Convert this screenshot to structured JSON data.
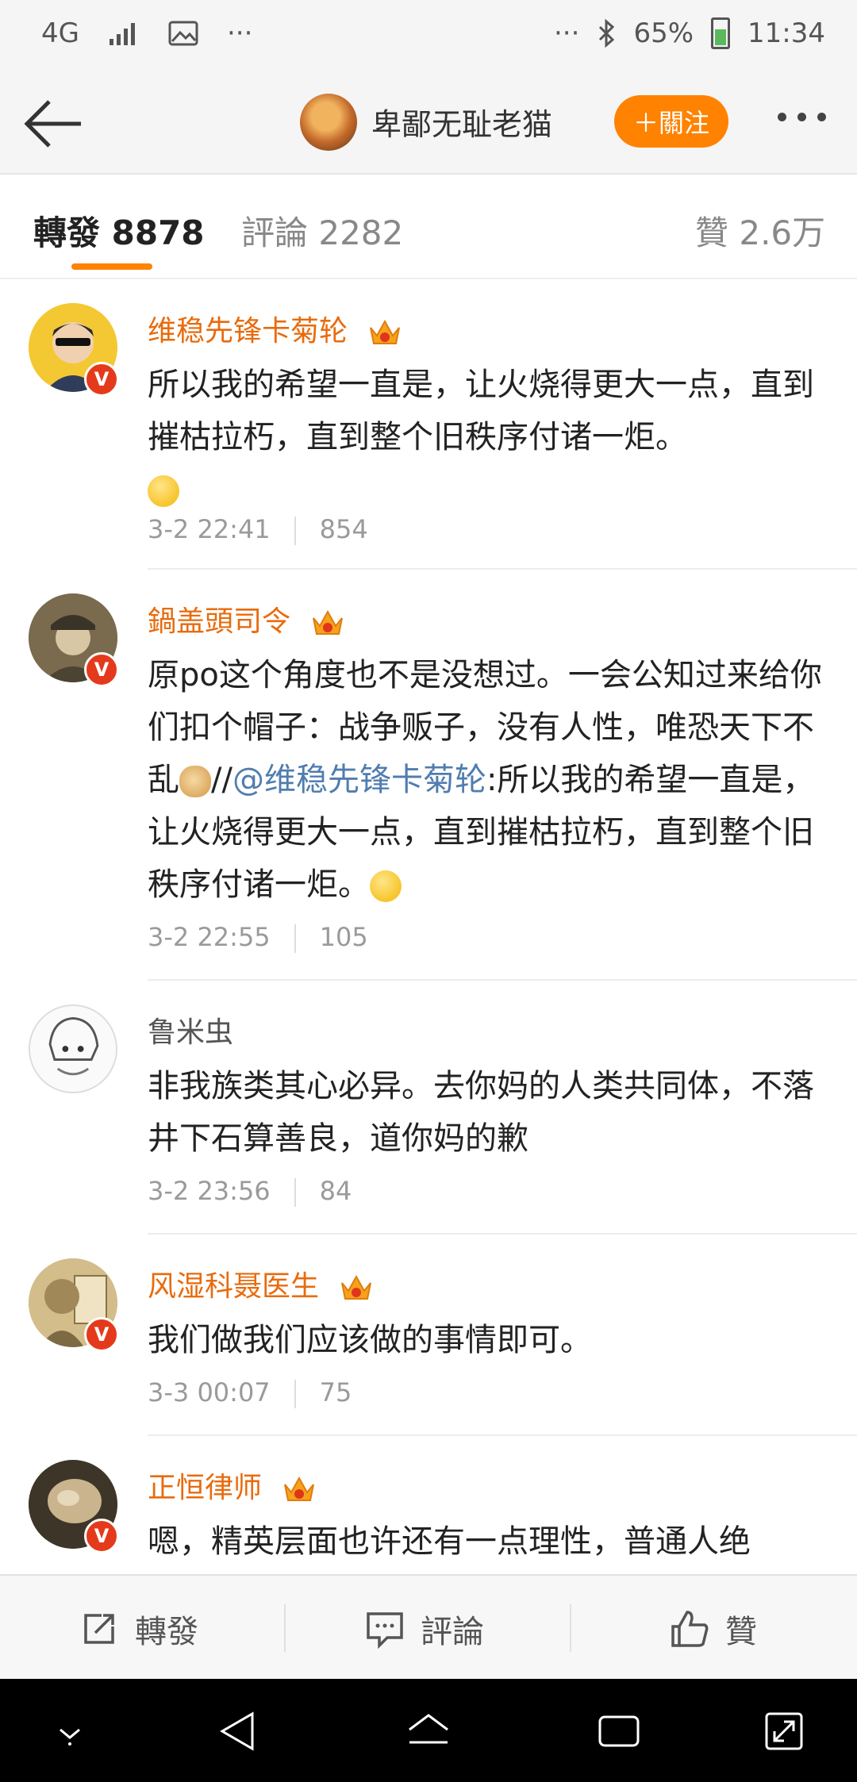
{
  "status_bar": {
    "network": "4G",
    "more": "···",
    "right_more": "···",
    "battery": "65%",
    "time": "11:34"
  },
  "header": {
    "title": "卑鄙无耻老猫",
    "follow_label": "＋關注"
  },
  "tabs": {
    "repost": "轉發 8878",
    "comment": "評論 2282",
    "like": "贊 2.6万"
  },
  "reposts": [
    {
      "user": "维稳先锋卡菊轮",
      "text": "所以我的希望一直是，让火烧得更大一点，直到摧枯拉朽，直到整个旧秩序付诸一炬。",
      "time": "3-2 22:41",
      "count": "854"
    },
    {
      "user": "鍋盖頭司令",
      "text_before": "原po这个角度也不是没想过。一会公知过来给你们扣个帽子：战争贩子，没有人性，唯恐天下不乱",
      "slashes": "//",
      "mention": "@维稳先锋卡菊轮",
      "text_after": ":所以我的希望一直是，让火烧得更大一点，直到摧枯拉朽，直到整个旧秩序付诸一炬。",
      "time": "3-2 22:55",
      "count": "105"
    },
    {
      "user": "鲁米虫",
      "text": "非我族类其心必异。去你妈的人类共同体，不落井下石算善良，道你妈的歉",
      "time": "3-2 23:56",
      "count": "84"
    },
    {
      "user": "风湿科聂医生",
      "text": "我们做我们应该做的事情即可。",
      "time": "3-3 00:07",
      "count": "75"
    },
    {
      "user": "正恒律师",
      "text": "嗯，精英层面也许还有一点理性，普通人绝"
    }
  ],
  "actions": {
    "repost": "轉發",
    "comment": "評論",
    "like": "贊"
  },
  "colors": {
    "accent": "#ff8200",
    "username": "#e86b0c",
    "mention": "#507daf",
    "verified_badge": "#e43a1b"
  }
}
